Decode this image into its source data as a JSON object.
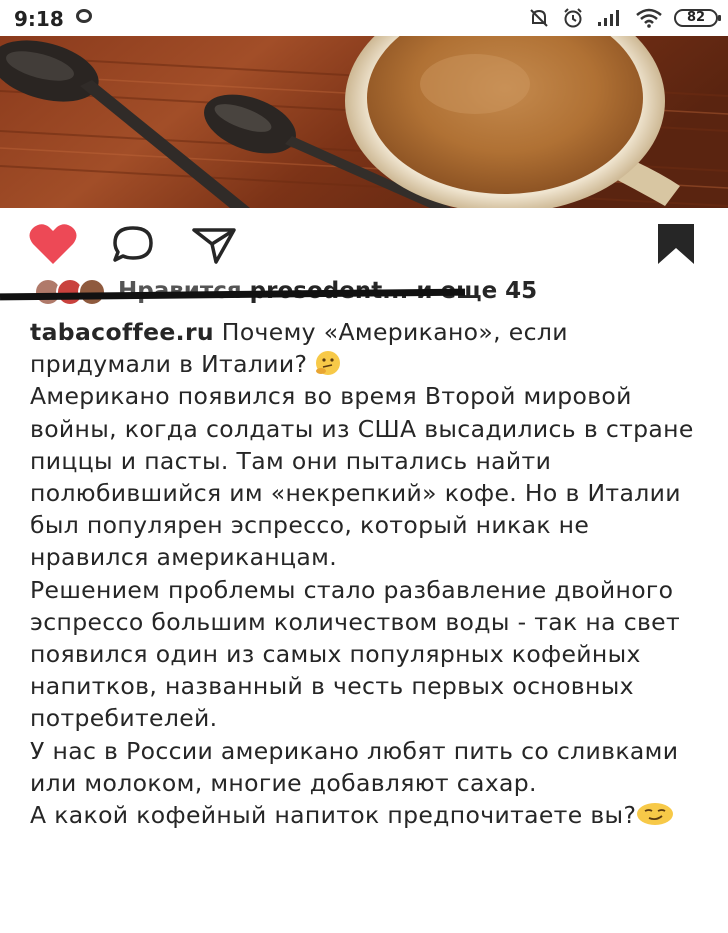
{
  "status_bar": {
    "time": "9:18",
    "battery": "82",
    "icons": [
      "chat-bubble-icon",
      "bell-off-icon",
      "alarm-icon",
      "signal-icon",
      "wifi-icon",
      "battery-icon"
    ]
  },
  "post": {
    "image_description_icon": "coffee-cup-with-spoons-photo",
    "actions": [
      "heart-icon",
      "comment-icon",
      "share-icon",
      "bookmark-icon"
    ],
    "colors": {
      "like": "#ed4956",
      "text": "#262626",
      "strike": "#111111"
    },
    "likes": {
      "liked_by_prefix": "Нравится",
      "liked_by_user": "prosodent...",
      "and_more": "и еще 45"
    },
    "caption": {
      "username": "tabacoffee.ru",
      "title": "Почему «Американо», если придумали в Италии?",
      "paragraphs": [
        "Американо появился во время Второй мировой войны, когда солдаты из США высадились в стране пиццы и пасты. Там они пытались найти полюбившийся им «некрепкий» кофе. Но в Италии был популярен эспрессо, который никак не нравился американцам.",
        "Решением проблемы стало разбавление двойного эспрессо большим количеством воды - так на свет появился один из самых популярных кофейных напитков, названный в честь первых основных потребителей.",
        "У нас в России американо любят пить со сливками или молоком, многие добавляют сахар.",
        "А какой кофейный напиток предпочитаете вы?"
      ],
      "emoji_icons": [
        "thinking-face-emoji",
        "smirking-face-emoji"
      ]
    }
  }
}
